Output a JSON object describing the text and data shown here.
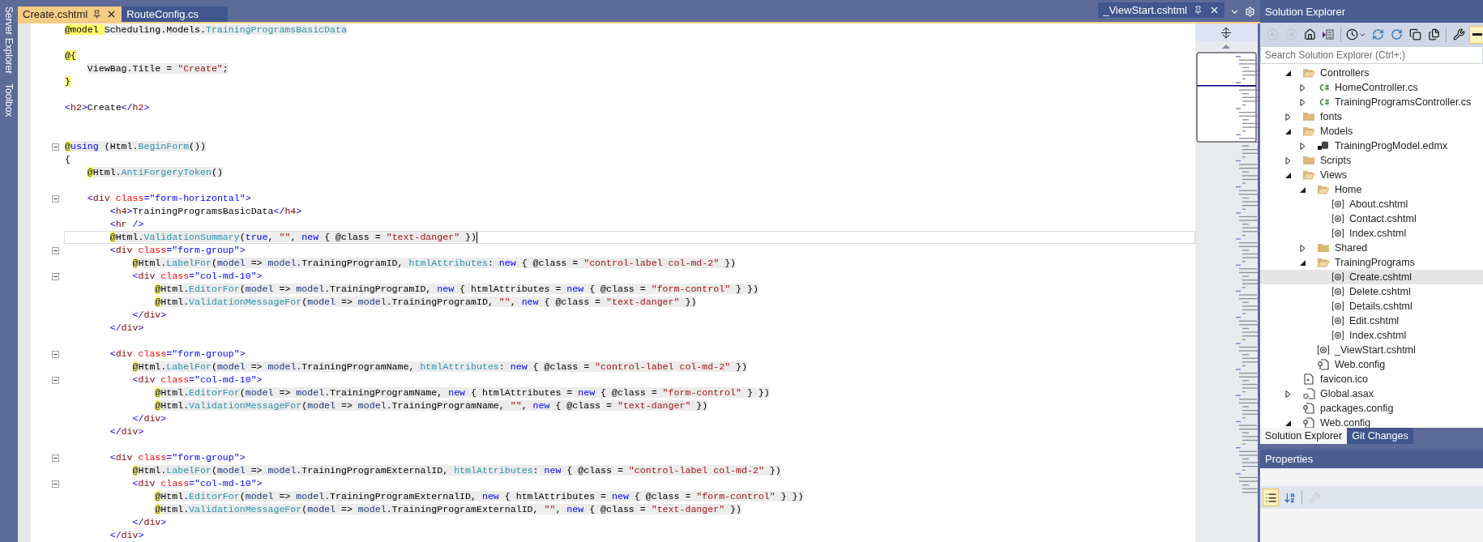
{
  "side_tool_windows": [
    {
      "label": "Server Explorer"
    },
    {
      "label": "Toolbox"
    }
  ],
  "document_tabs": [
    {
      "label": "Create.cshtml",
      "selected": true
    },
    {
      "label": "RouteConfig.cs",
      "selected": false
    }
  ],
  "preview_tab": {
    "label": "_ViewStart.cshtml"
  },
  "code": {
    "lines": [
      {
        "fold": false,
        "current": false,
        "segments": [
          {
            "kind": "at",
            "text": "@model "
          },
          {
            "kind": "code",
            "text": "Scheduling.Models."
          },
          {
            "kind": "type",
            "text": "TrainingProgramsBasicData"
          }
        ]
      },
      {
        "fold": false,
        "current": false
      },
      {
        "fold": false,
        "current": false,
        "segments": [
          {
            "kind": "at",
            "text": "@{"
          }
        ]
      },
      {
        "fold": false,
        "current": false,
        "segments": [
          {
            "kind": "code",
            "text": "    ViewBag.Title = "
          },
          {
            "kind": "str",
            "text": "\"Create\""
          },
          {
            "kind": "code",
            "text": ";"
          }
        ]
      },
      {
        "fold": false,
        "current": false,
        "segments": [
          {
            "kind": "at",
            "text": "}"
          }
        ]
      },
      {
        "fold": false,
        "current": false
      },
      {
        "fold": false,
        "current": false,
        "segments": [
          {
            "kind": "lt",
            "text": "<"
          },
          {
            "kind": "el",
            "text": "h2"
          },
          {
            "kind": "lt",
            "text": ">"
          },
          {
            "kind": "txt",
            "text": "Create"
          },
          {
            "kind": "lt",
            "text": "</"
          },
          {
            "kind": "el",
            "text": "h2"
          },
          {
            "kind": "lt",
            "text": ">"
          }
        ]
      },
      {
        "fold": false,
        "current": false
      },
      {
        "fold": false,
        "current": false
      },
      {
        "fold": true,
        "current": false,
        "segments": [
          {
            "kind": "at",
            "text": "@"
          },
          {
            "kind": "kw",
            "text": "using"
          },
          {
            "kind": "code",
            "text": " (Html."
          },
          {
            "kind": "meth",
            "text": "BeginForm"
          },
          {
            "kind": "code",
            "text": "())"
          }
        ]
      },
      {
        "fold": false,
        "current": false,
        "segments": [
          {
            "kind": "txt",
            "text": "{"
          }
        ]
      },
      {
        "fold": false,
        "current": false,
        "segments": [
          {
            "kind": "at",
            "text": "    @"
          },
          {
            "kind": "code",
            "text": "Html."
          },
          {
            "kind": "meth",
            "text": "AntiForgeryToken"
          },
          {
            "kind": "code",
            "text": "()"
          }
        ]
      },
      {
        "fold": false,
        "current": false
      },
      {
        "fold": true,
        "current": false,
        "segments": [
          {
            "kind": "lt",
            "text": "    <"
          },
          {
            "kind": "el",
            "text": "div"
          },
          {
            "kind": "attr",
            "text": " class"
          },
          {
            "kind": "lt",
            "text": "="
          },
          {
            "kind": "aval",
            "text": "\"form-horizontal\""
          },
          {
            "kind": "lt",
            "text": ">"
          }
        ]
      },
      {
        "fold": false,
        "current": false,
        "segments": [
          {
            "kind": "lt",
            "text": "        <"
          },
          {
            "kind": "el",
            "text": "h4"
          },
          {
            "kind": "lt",
            "text": ">"
          },
          {
            "kind": "txt",
            "text": "TrainingProgramsBasicData"
          },
          {
            "kind": "lt",
            "text": "</"
          },
          {
            "kind": "el",
            "text": "h4"
          },
          {
            "kind": "lt",
            "text": ">"
          }
        ]
      },
      {
        "fold": false,
        "current": false,
        "segments": [
          {
            "kind": "lt",
            "text": "        <"
          },
          {
            "kind": "el",
            "text": "hr"
          },
          {
            "kind": "lt",
            "text": " />"
          }
        ]
      },
      {
        "fold": false,
        "current": true,
        "segments": [
          {
            "kind": "at",
            "text": "        @"
          },
          {
            "kind": "code",
            "text": "Html."
          },
          {
            "kind": "meth",
            "text": "ValidationSummary"
          },
          {
            "kind": "code",
            "text": "("
          },
          {
            "kind": "kw",
            "text": "true"
          },
          {
            "kind": "code",
            "text": ", "
          },
          {
            "kind": "str",
            "text": "\"\""
          },
          {
            "kind": "code",
            "text": ", "
          },
          {
            "kind": "kw",
            "text": "new"
          },
          {
            "kind": "code",
            "text": " { @class = "
          },
          {
            "kind": "str",
            "text": "\"text-danger\""
          },
          {
            "kind": "code",
            "text": " })"
          }
        ]
      },
      {
        "fold": true,
        "current": false,
        "segments": [
          {
            "kind": "lt",
            "text": "        <"
          },
          {
            "kind": "el",
            "text": "div"
          },
          {
            "kind": "attr",
            "text": " class"
          },
          {
            "kind": "lt",
            "text": "="
          },
          {
            "kind": "aval",
            "text": "\"form-group\""
          },
          {
            "kind": "lt",
            "text": ">"
          }
        ]
      },
      {
        "fold": false,
        "current": false,
        "segments": [
          {
            "kind": "at",
            "text": "            @"
          },
          {
            "kind": "code",
            "text": "Html."
          },
          {
            "kind": "meth",
            "text": "LabelFor"
          },
          {
            "kind": "code",
            "text": "("
          },
          {
            "kind": "param",
            "text": "model"
          },
          {
            "kind": "code",
            "text": " => "
          },
          {
            "kind": "param",
            "text": "model"
          },
          {
            "kind": "code",
            "text": ".TrainingProgramID, "
          },
          {
            "kind": "meth",
            "text": "htmlAttributes"
          },
          {
            "kind": "code",
            "text": ": "
          },
          {
            "kind": "kw",
            "text": "new"
          },
          {
            "kind": "code",
            "text": " { @class = "
          },
          {
            "kind": "str",
            "text": "\"control-label col-md-2\""
          },
          {
            "kind": "code",
            "text": " })"
          }
        ]
      },
      {
        "fold": true,
        "current": false,
        "segments": [
          {
            "kind": "lt",
            "text": "            <"
          },
          {
            "kind": "el",
            "text": "div"
          },
          {
            "kind": "attr",
            "text": " class"
          },
          {
            "kind": "lt",
            "text": "="
          },
          {
            "kind": "aval",
            "text": "\"col-md-10\""
          },
          {
            "kind": "lt",
            "text": ">"
          }
        ]
      },
      {
        "fold": false,
        "current": false,
        "segments": [
          {
            "kind": "at",
            "text": "                @"
          },
          {
            "kind": "code",
            "text": "Html."
          },
          {
            "kind": "meth",
            "text": "EditorFor"
          },
          {
            "kind": "code",
            "text": "("
          },
          {
            "kind": "param",
            "text": "model"
          },
          {
            "kind": "code",
            "text": " => "
          },
          {
            "kind": "param",
            "text": "model"
          },
          {
            "kind": "code",
            "text": ".TrainingProgramID, "
          },
          {
            "kind": "kw",
            "text": "new"
          },
          {
            "kind": "code",
            "text": " { htmlAttributes = "
          },
          {
            "kind": "kw",
            "text": "new"
          },
          {
            "kind": "code",
            "text": " { @class = "
          },
          {
            "kind": "str",
            "text": "\"form-control\""
          },
          {
            "kind": "code",
            "text": " } })"
          }
        ]
      },
      {
        "fold": false,
        "current": false,
        "segments": [
          {
            "kind": "at",
            "text": "                @"
          },
          {
            "kind": "code",
            "text": "Html."
          },
          {
            "kind": "meth",
            "text": "ValidationMessageFor"
          },
          {
            "kind": "code",
            "text": "("
          },
          {
            "kind": "param",
            "text": "model"
          },
          {
            "kind": "code",
            "text": " => "
          },
          {
            "kind": "param",
            "text": "model"
          },
          {
            "kind": "code",
            "text": ".TrainingProgramID, "
          },
          {
            "kind": "str",
            "text": "\"\""
          },
          {
            "kind": "code",
            "text": ", "
          },
          {
            "kind": "kw",
            "text": "new"
          },
          {
            "kind": "code",
            "text": " { @class = "
          },
          {
            "kind": "str",
            "text": "\"text-danger\""
          },
          {
            "kind": "code",
            "text": " })"
          }
        ]
      },
      {
        "fold": false,
        "current": false,
        "segments": [
          {
            "kind": "lt",
            "text": "            </"
          },
          {
            "kind": "el",
            "text": "div"
          },
          {
            "kind": "lt",
            "text": ">"
          }
        ]
      },
      {
        "fold": false,
        "current": false,
        "segments": [
          {
            "kind": "lt",
            "text": "        </"
          },
          {
            "kind": "el",
            "text": "div"
          },
          {
            "kind": "lt",
            "text": ">"
          }
        ]
      },
      {
        "fold": false,
        "current": false
      },
      {
        "fold": true,
        "current": false,
        "segments": [
          {
            "kind": "lt",
            "text": "        <"
          },
          {
            "kind": "el",
            "text": "div"
          },
          {
            "kind": "attr",
            "text": " class"
          },
          {
            "kind": "lt",
            "text": "="
          },
          {
            "kind": "aval",
            "text": "\"form-group\""
          },
          {
            "kind": "lt",
            "text": ">"
          }
        ]
      },
      {
        "fold": false,
        "current": false,
        "segments": [
          {
            "kind": "at",
            "text": "            @"
          },
          {
            "kind": "code",
            "text": "Html."
          },
          {
            "kind": "meth",
            "text": "LabelFor"
          },
          {
            "kind": "code",
            "text": "("
          },
          {
            "kind": "param",
            "text": "model"
          },
          {
            "kind": "code",
            "text": " => "
          },
          {
            "kind": "param",
            "text": "model"
          },
          {
            "kind": "code",
            "text": ".TrainingProgramName, "
          },
          {
            "kind": "meth",
            "text": "htmlAttributes"
          },
          {
            "kind": "code",
            "text": ": "
          },
          {
            "kind": "kw",
            "text": "new"
          },
          {
            "kind": "code",
            "text": " { @class = "
          },
          {
            "kind": "str",
            "text": "\"control-label col-md-2\""
          },
          {
            "kind": "code",
            "text": " })"
          }
        ]
      },
      {
        "fold": true,
        "current": false,
        "segments": [
          {
            "kind": "lt",
            "text": "            <"
          },
          {
            "kind": "el",
            "text": "div"
          },
          {
            "kind": "attr",
            "text": " class"
          },
          {
            "kind": "lt",
            "text": "="
          },
          {
            "kind": "aval",
            "text": "\"col-md-10\""
          },
          {
            "kind": "lt",
            "text": ">"
          }
        ]
      },
      {
        "fold": false,
        "current": false,
        "segments": [
          {
            "kind": "at",
            "text": "                @"
          },
          {
            "kind": "code",
            "text": "Html."
          },
          {
            "kind": "meth",
            "text": "EditorFor"
          },
          {
            "kind": "code",
            "text": "("
          },
          {
            "kind": "param",
            "text": "model"
          },
          {
            "kind": "code",
            "text": " => "
          },
          {
            "kind": "param",
            "text": "model"
          },
          {
            "kind": "code",
            "text": ".TrainingProgramName, "
          },
          {
            "kind": "kw",
            "text": "new"
          },
          {
            "kind": "code",
            "text": " { htmlAttributes = "
          },
          {
            "kind": "kw",
            "text": "new"
          },
          {
            "kind": "code",
            "text": " { @class = "
          },
          {
            "kind": "str",
            "text": "\"form-control\""
          },
          {
            "kind": "code",
            "text": " } })"
          }
        ]
      },
      {
        "fold": false,
        "current": false,
        "segments": [
          {
            "kind": "at",
            "text": "                @"
          },
          {
            "kind": "code",
            "text": "Html."
          },
          {
            "kind": "meth",
            "text": "ValidationMessageFor"
          },
          {
            "kind": "code",
            "text": "("
          },
          {
            "kind": "param",
            "text": "model"
          },
          {
            "kind": "code",
            "text": " => "
          },
          {
            "kind": "param",
            "text": "model"
          },
          {
            "kind": "code",
            "text": ".TrainingProgramName, "
          },
          {
            "kind": "str",
            "text": "\"\""
          },
          {
            "kind": "code",
            "text": ", "
          },
          {
            "kind": "kw",
            "text": "new"
          },
          {
            "kind": "code",
            "text": " { @class = "
          },
          {
            "kind": "str",
            "text": "\"text-danger\""
          },
          {
            "kind": "code",
            "text": " })"
          }
        ]
      },
      {
        "fold": false,
        "current": false,
        "segments": [
          {
            "kind": "lt",
            "text": "            </"
          },
          {
            "kind": "el",
            "text": "div"
          },
          {
            "kind": "lt",
            "text": ">"
          }
        ]
      },
      {
        "fold": false,
        "current": false,
        "segments": [
          {
            "kind": "lt",
            "text": "        </"
          },
          {
            "kind": "el",
            "text": "div"
          },
          {
            "kind": "lt",
            "text": ">"
          }
        ]
      },
      {
        "fold": false,
        "current": false
      },
      {
        "fold": true,
        "current": false,
        "segments": [
          {
            "kind": "lt",
            "text": "        <"
          },
          {
            "kind": "el",
            "text": "div"
          },
          {
            "kind": "attr",
            "text": " class"
          },
          {
            "kind": "lt",
            "text": "="
          },
          {
            "kind": "aval",
            "text": "\"form-group\""
          },
          {
            "kind": "lt",
            "text": ">"
          }
        ]
      },
      {
        "fold": false,
        "current": false,
        "segments": [
          {
            "kind": "at",
            "text": "            @"
          },
          {
            "kind": "code",
            "text": "Html."
          },
          {
            "kind": "meth",
            "text": "LabelFor"
          },
          {
            "kind": "code",
            "text": "("
          },
          {
            "kind": "param",
            "text": "model"
          },
          {
            "kind": "code",
            "text": " => "
          },
          {
            "kind": "param",
            "text": "model"
          },
          {
            "kind": "code",
            "text": ".TrainingProgramExternalID, "
          },
          {
            "kind": "meth",
            "text": "htmlAttributes"
          },
          {
            "kind": "code",
            "text": ": "
          },
          {
            "kind": "kw",
            "text": "new"
          },
          {
            "kind": "code",
            "text": " { @class = "
          },
          {
            "kind": "str",
            "text": "\"control-label col-md-2\""
          },
          {
            "kind": "code",
            "text": " })"
          }
        ]
      },
      {
        "fold": true,
        "current": false,
        "segments": [
          {
            "kind": "lt",
            "text": "            <"
          },
          {
            "kind": "el",
            "text": "div"
          },
          {
            "kind": "attr",
            "text": " class"
          },
          {
            "kind": "lt",
            "text": "="
          },
          {
            "kind": "aval",
            "text": "\"col-md-10\""
          },
          {
            "kind": "lt",
            "text": ">"
          }
        ]
      },
      {
        "fold": false,
        "current": false,
        "segments": [
          {
            "kind": "at",
            "text": "                @"
          },
          {
            "kind": "code",
            "text": "Html."
          },
          {
            "kind": "meth",
            "text": "EditorFor"
          },
          {
            "kind": "code",
            "text": "("
          },
          {
            "kind": "param",
            "text": "model"
          },
          {
            "kind": "code",
            "text": " => "
          },
          {
            "kind": "param",
            "text": "model"
          },
          {
            "kind": "code",
            "text": ".TrainingProgramExternalID, "
          },
          {
            "kind": "kw",
            "text": "new"
          },
          {
            "kind": "code",
            "text": " { htmlAttributes = "
          },
          {
            "kind": "kw",
            "text": "new"
          },
          {
            "kind": "code",
            "text": " { @class = "
          },
          {
            "kind": "str",
            "text": "\"form-control\""
          },
          {
            "kind": "code",
            "text": " } })"
          }
        ]
      },
      {
        "fold": false,
        "current": false,
        "segments": [
          {
            "kind": "at",
            "text": "                @"
          },
          {
            "kind": "code",
            "text": "Html."
          },
          {
            "kind": "meth",
            "text": "ValidationMessageFor"
          },
          {
            "kind": "code",
            "text": "("
          },
          {
            "kind": "param",
            "text": "model"
          },
          {
            "kind": "code",
            "text": " => "
          },
          {
            "kind": "param",
            "text": "model"
          },
          {
            "kind": "code",
            "text": ".TrainingProgramExternalID, "
          },
          {
            "kind": "str",
            "text": "\"\""
          },
          {
            "kind": "code",
            "text": ", "
          },
          {
            "kind": "kw",
            "text": "new"
          },
          {
            "kind": "code",
            "text": " { @class = "
          },
          {
            "kind": "str",
            "text": "\"text-danger\""
          },
          {
            "kind": "code",
            "text": " })"
          }
        ]
      },
      {
        "fold": false,
        "current": false,
        "segments": [
          {
            "kind": "lt",
            "text": "            </"
          },
          {
            "kind": "el",
            "text": "div"
          },
          {
            "kind": "lt",
            "text": ">"
          }
        ]
      },
      {
        "fold": false,
        "current": false,
        "segments": [
          {
            "kind": "lt",
            "text": "        </"
          },
          {
            "kind": "el",
            "text": "div"
          },
          {
            "kind": "lt",
            "text": ">"
          }
        ]
      }
    ]
  },
  "solution_explorer": {
    "title": "Solution Explorer",
    "toolbar": [
      {
        "kind": "back",
        "disabled": true,
        "pressed": false
      },
      {
        "kind": "forward",
        "disabled": true,
        "pressed": false
      },
      {
        "kind": "home",
        "disabled": false,
        "pressed": false
      },
      {
        "kind": "switch-views",
        "disabled": false,
        "pressed": false
      },
      {
        "kind": "pending-changes",
        "disabled": false,
        "pressed": false
      },
      {
        "kind": "sync",
        "disabled": false,
        "pressed": false
      },
      {
        "kind": "refresh",
        "disabled": false,
        "pressed": false
      },
      {
        "kind": "collapse-all",
        "disabled": false,
        "pressed": false
      },
      {
        "kind": "show-all-files",
        "disabled": false,
        "pressed": false
      },
      {
        "kind": "properties",
        "disabled": false,
        "pressed": false
      },
      {
        "kind": "preview",
        "disabled": false,
        "pressed": true
      }
    ],
    "search": {
      "placeholder": "Search Solution Explorer (Ctrl+;)"
    },
    "items": [
      {
        "label": "Controllers",
        "kind": "folder",
        "expanded": true,
        "selected": false,
        "children": [
          {
            "label": "HomeController.cs",
            "kind": "csharp",
            "expanded": false,
            "selected": false
          },
          {
            "label": "TrainingProgramsController.cs",
            "kind": "csharp",
            "expanded": false,
            "selected": false
          }
        ]
      },
      {
        "label": "fonts",
        "kind": "folder",
        "expanded": false,
        "selected": false
      },
      {
        "label": "Models",
        "kind": "folder",
        "expanded": true,
        "selected": false,
        "children": [
          {
            "label": "TrainingProgModel.edmx",
            "kind": "edmx",
            "expanded": false,
            "selected": false
          }
        ]
      },
      {
        "label": "Scripts",
        "kind": "folder",
        "expanded": false,
        "selected": false
      },
      {
        "label": "Views",
        "kind": "folder",
        "expanded": true,
        "selected": false,
        "children": [
          {
            "label": "Home",
            "kind": "folder",
            "expanded": true,
            "selected": false,
            "children": [
              {
                "label": "About.cshtml",
                "kind": "razor",
                "selected": false
              },
              {
                "label": "Contact.cshtml",
                "kind": "razor",
                "selected": false
              },
              {
                "label": "Index.cshtml",
                "kind": "razor",
                "selected": false
              }
            ]
          },
          {
            "label": "Shared",
            "kind": "folder",
            "expanded": false,
            "selected": false
          },
          {
            "label": "TrainingPrograms",
            "kind": "folder",
            "expanded": true,
            "selected": false,
            "children": [
              {
                "label": "Create.cshtml",
                "kind": "razor",
                "selected": true
              },
              {
                "label": "Delete.cshtml",
                "kind": "razor",
                "selected": false
              },
              {
                "label": "Details.cshtml",
                "kind": "razor",
                "selected": false
              },
              {
                "label": "Edit.cshtml",
                "kind": "razor",
                "selected": false
              },
              {
                "label": "Index.cshtml",
                "kind": "razor",
                "selected": false
              }
            ]
          },
          {
            "label": "_ViewStart.cshtml",
            "kind": "razor",
            "selected": false
          },
          {
            "label": "Web.config",
            "kind": "config",
            "selected": false
          }
        ]
      },
      {
        "label": "favicon.ico",
        "kind": "ico",
        "selected": false
      },
      {
        "label": "Global.asax",
        "kind": "asax",
        "expanded": false,
        "selected": false
      },
      {
        "label": "packages.config",
        "kind": "config",
        "selected": false
      },
      {
        "label": "Web.config",
        "kind": "config",
        "expanded": true,
        "selected": false
      }
    ],
    "tabs": [
      {
        "label": "Solution Explorer",
        "selected": true
      },
      {
        "label": "Git Changes",
        "selected": false
      }
    ]
  },
  "properties": {
    "title": "Properties",
    "toolbar": [
      {
        "kind": "categorized",
        "disabled": false,
        "pressed": true
      },
      {
        "kind": "alphabetical",
        "disabled": false,
        "pressed": false
      },
      {
        "kind": "property-pages",
        "disabled": true,
        "pressed": false
      }
    ]
  }
}
